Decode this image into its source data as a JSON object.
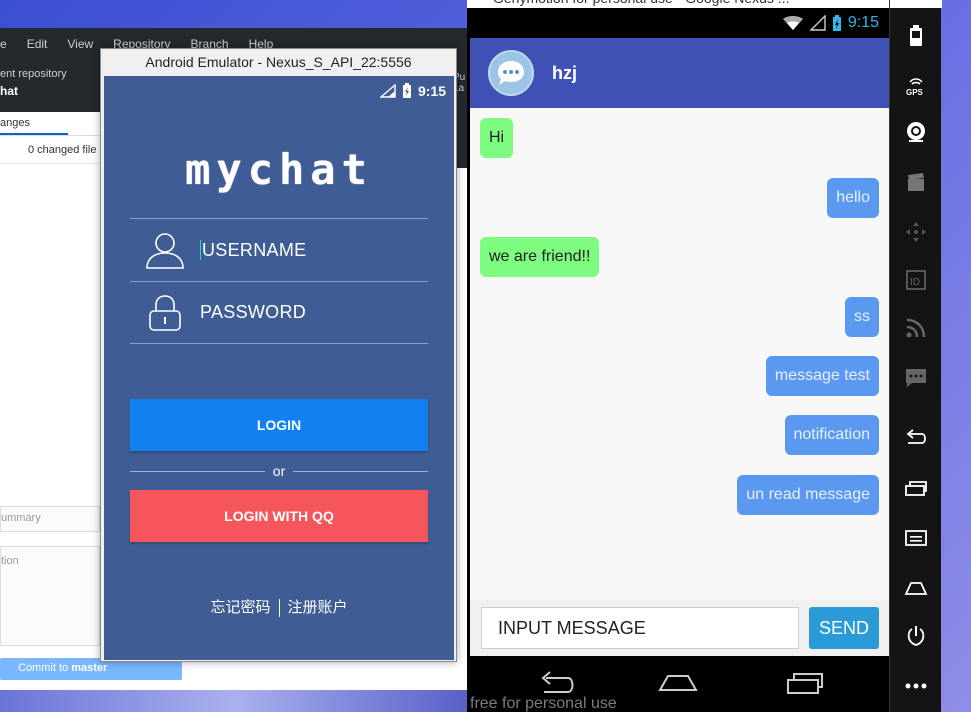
{
  "github": {
    "menu": [
      "e",
      "Edit",
      "View",
      "Repository",
      "Branch",
      "Help"
    ],
    "repo_label": "ent repository",
    "repo_name": "hat",
    "changes_tab": "anges",
    "changed_files": "0 changed file",
    "summary_placeholder": "ummary",
    "description_placeholder": "tion",
    "commit_prefix": "Commit to ",
    "commit_branch": "master",
    "right_fragment_1": "Pu",
    "right_fragment_2": "La"
  },
  "emulator": {
    "window_title": "Android Emulator - Nexus_S_API_22:5556",
    "status_time": "9:15",
    "logo": "mychat",
    "username_placeholder": "USERNAME",
    "password_placeholder": "PASSWORD",
    "login_label": "LOGIN",
    "or_label": "or",
    "qq_login_label": "LOGIN WITH QQ",
    "forgot_password": "忘记密码",
    "register": "注册账户"
  },
  "genymotion": {
    "window_title": "Genymotion for personal use - Google Nexus ...",
    "status_time": "9:15",
    "contact_name": "hzj",
    "messages": [
      {
        "side": "left",
        "text": "Hi"
      },
      {
        "side": "right",
        "text": "hello"
      },
      {
        "side": "left",
        "text": "we are friend!!"
      },
      {
        "side": "right",
        "text": "ss"
      },
      {
        "side": "right",
        "text": "message test"
      },
      {
        "side": "right",
        "text": "notification"
      },
      {
        "side": "right",
        "text": "un read message"
      }
    ],
    "input_text": "INPUT MESSAGE",
    "send_label": "SEND",
    "watermark": "free for personal use",
    "sidebar_icons": [
      "battery-icon",
      "gps-icon",
      "camera-icon",
      "video-icon",
      "dpad-icon",
      "id-icon",
      "rss-icon",
      "sms-icon",
      "back-icon",
      "recent-apps-icon",
      "menu-icon",
      "home-icon",
      "power-icon",
      "more-icon"
    ]
  },
  "colors": {
    "emulator_bg": "#405c94",
    "login_blue": "#1281f0",
    "qq_red": "#f6565b",
    "appbar": "#3f51b5",
    "bubble_left": "#7dfc7f",
    "bubble_right": "#5b99f0",
    "send": "#2a9bd6"
  }
}
